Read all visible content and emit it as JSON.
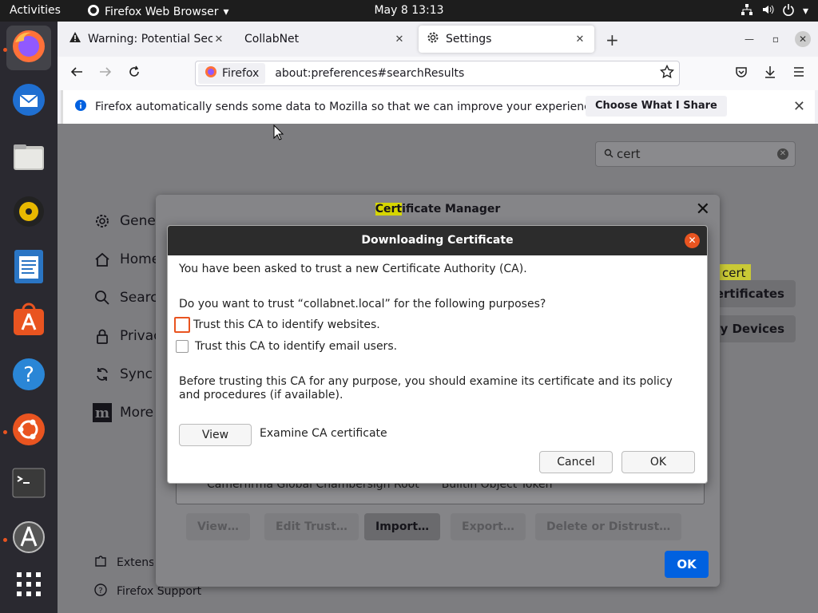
{
  "topbar": {
    "activities": "Activities",
    "app_name": "Firefox Web Browser",
    "clock": "May 8  13:13"
  },
  "dock": {
    "items": [
      "firefox",
      "thunderbird",
      "files",
      "rhythmbox",
      "writer",
      "app-center",
      "help",
      "ubuntu",
      "terminal",
      "updater",
      "show-apps"
    ]
  },
  "tabs": [
    {
      "title": "Warning: Potential Security Risk Ahead",
      "icon": "warning-icon"
    },
    {
      "title": "CollabNet",
      "icon": ""
    },
    {
      "title": "Settings",
      "icon": "gear-icon"
    }
  ],
  "navbar": {
    "identity": "Firefox",
    "url": "about:preferences#searchResults"
  },
  "notification": {
    "message": "Firefox automatically sends some data to Mozilla so that we can improve your experience.",
    "button": "Choose What I Share"
  },
  "settings": {
    "search_value": "cert",
    "categories": [
      "General",
      "Home",
      "Search",
      "Privacy & Security",
      "Sync",
      "More from Mozilla"
    ],
    "footer": [
      "Extensions & Themes",
      "Firefox Support"
    ],
    "bg_highlight": "cert",
    "bg_buttons": [
      "View Certificates…",
      "Security Devices…"
    ]
  },
  "cert_manager": {
    "title_highlight": "Cert",
    "title_rest": "ificate Manager",
    "tree_row": {
      "name": "Camerfirma Global Chambersign Root",
      "device": "Builtin Object Token"
    },
    "buttons": [
      "View…",
      "Edit Trust…",
      "Import…",
      "Export…",
      "Delete or Distrust…"
    ],
    "ok": "OK"
  },
  "download_dialog": {
    "title": "Downloading Certificate",
    "line1": "You have been asked to trust a new Certificate Authority (CA).",
    "question": "Do you want to trust “collabnet.local” for the following purposes?",
    "checkbox_websites": "Trust this CA to identify websites.",
    "checkbox_email": "Trust this CA to identify email users.",
    "warning": "Before trusting this CA for any purpose, you should examine its certificate and its policy and procedures (if available).",
    "view_button": "View",
    "view_label": "Examine CA certificate",
    "cancel": "Cancel",
    "ok": "OK"
  },
  "colors": {
    "accent": "#0061e0",
    "ubuntu_orange": "#e95420",
    "highlight": "#d6d600"
  }
}
